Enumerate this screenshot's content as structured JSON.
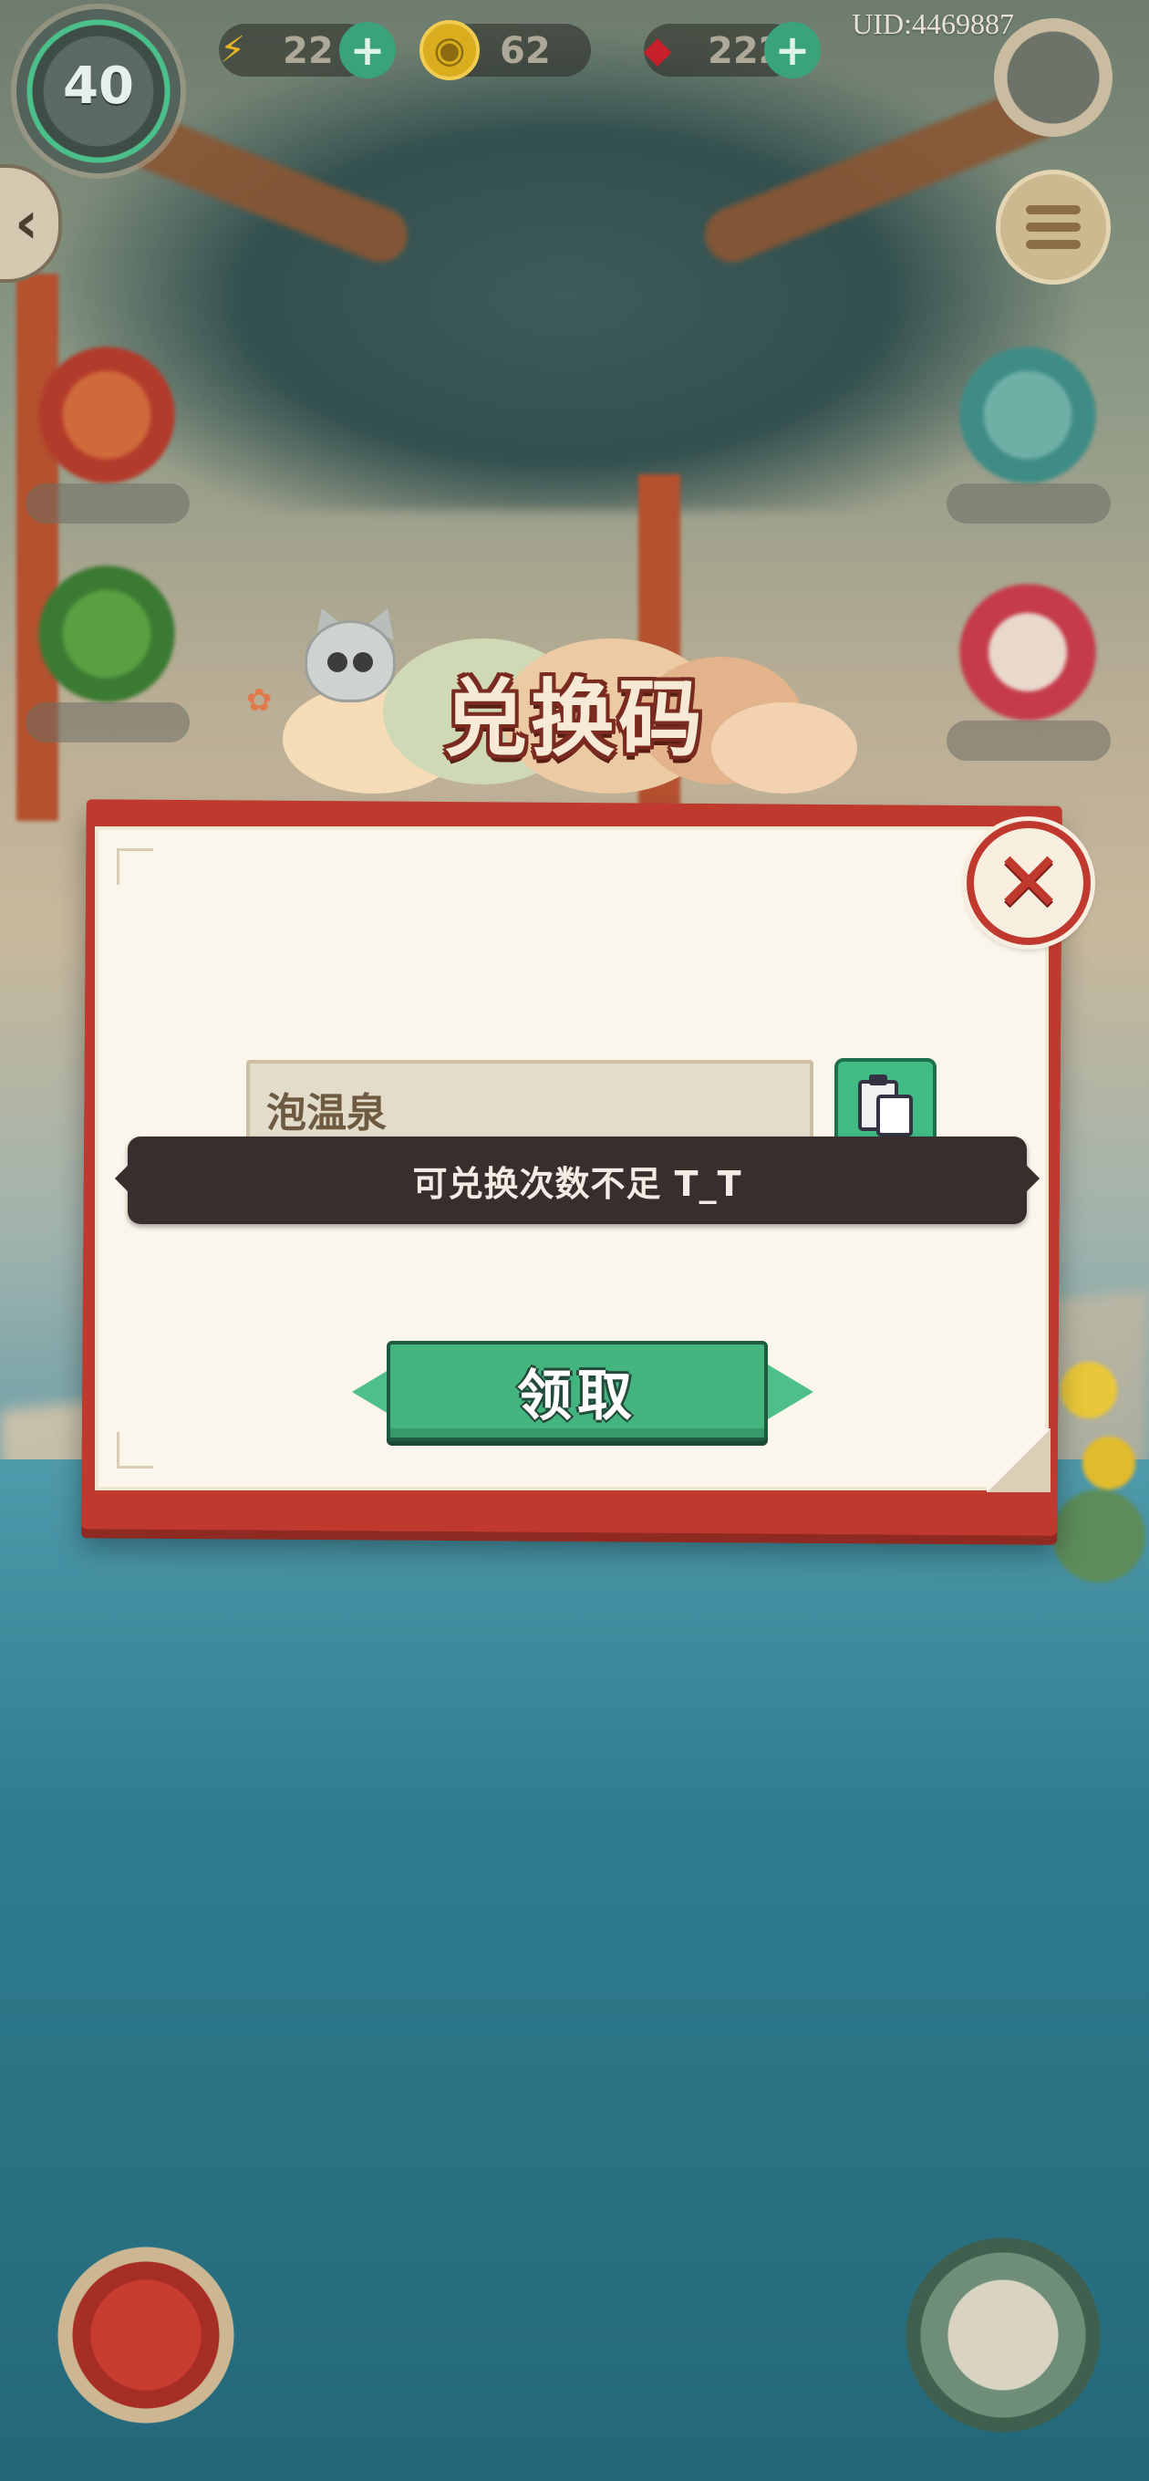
{
  "hud": {
    "uid": "UID:4469887",
    "level": "40",
    "energy": "22",
    "coins": "62",
    "gems": "222"
  },
  "dialog": {
    "title": "兑换码",
    "code_value": "泡温泉",
    "toast": "可兑换次数不足 T_T",
    "claim_label": "领取"
  },
  "icons": {
    "energy": "lightning-icon",
    "coin": "coin-icon",
    "gem": "gem-icon",
    "close": "close-icon",
    "paste": "clipboard-icon",
    "back": "back-arrow-icon",
    "menu": "menu-icon"
  },
  "colors": {
    "accent_red": "#c0392e",
    "accent_green": "#44b57f",
    "paper": "#fbf6ec",
    "toast_bg": "#3a2d2e"
  }
}
